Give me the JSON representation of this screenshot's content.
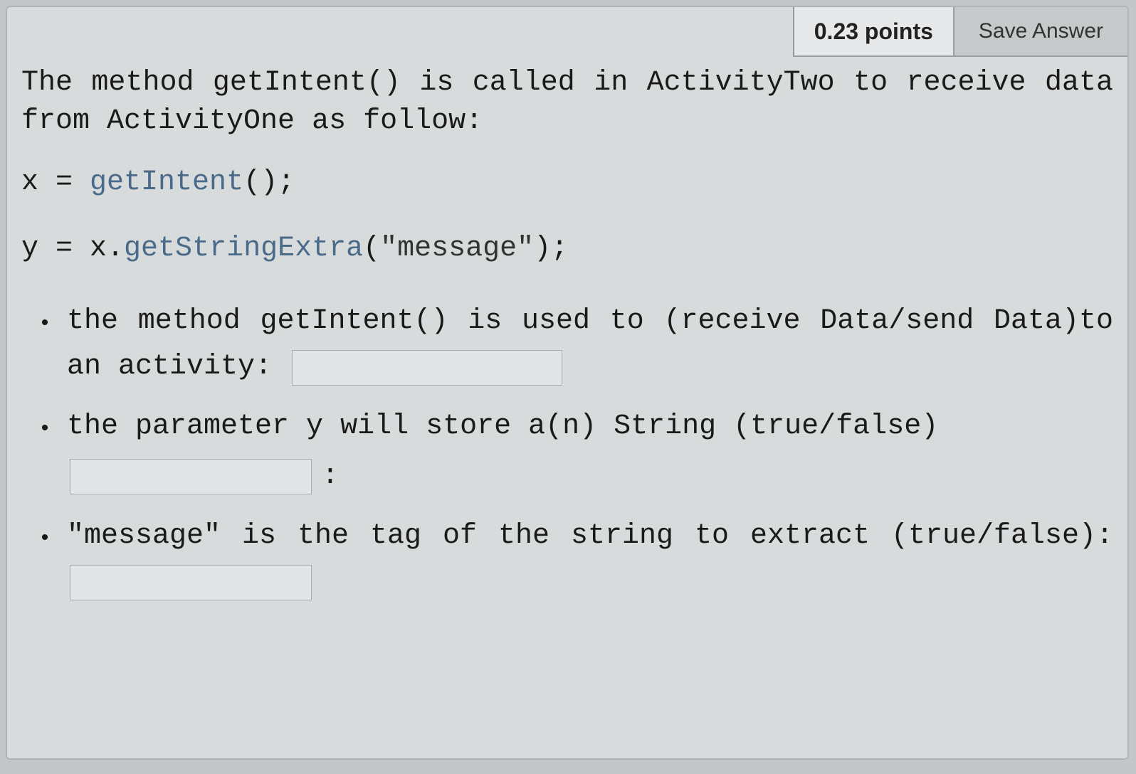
{
  "header": {
    "points_label": "0.23 points",
    "save_label": "Save Answer"
  },
  "intro": "The method getIntent() is called in ActivityTwo to receive data from ActivityOne as follow:",
  "code": {
    "line1_var": "x",
    "line1_eq": " = ",
    "line1_fn": "getIntent",
    "line1_suffix": "();",
    "line2_var": "y",
    "line2_eq": " = x.",
    "line2_fn": "getStringExtra",
    "line2_str": "\"message\"",
    "line2_suffix": ");",
    "line2_open": "("
  },
  "bullets": {
    "b1": {
      "pre": "the method getIntent() is used to (receive Data/send Data)to an activity:",
      "input_value": ""
    },
    "b2": {
      "pre": "the parameter y will store a(n) String (true/false)",
      "colon": ":",
      "input_value": ""
    },
    "b3": {
      "pre": "\"message\" is the tag of the string to extract (true/false):",
      "input_value": ""
    }
  }
}
